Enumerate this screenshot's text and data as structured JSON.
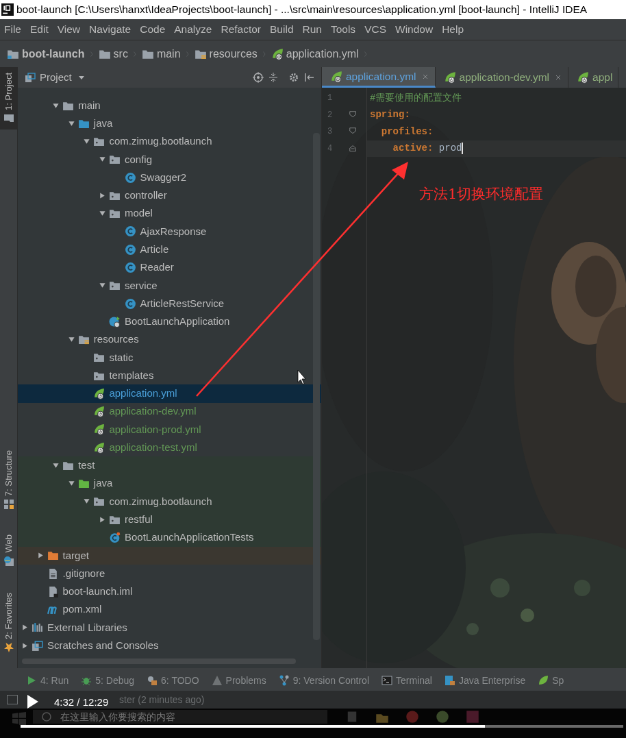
{
  "window": {
    "title": "boot-launch [C:\\Users\\hanxt\\IdeaProjects\\boot-launch] - ...\\src\\main\\resources\\application.yml [boot-launch] - IntelliJ IDEA"
  },
  "menu": [
    "File",
    "Edit",
    "View",
    "Navigate",
    "Code",
    "Analyze",
    "Refactor",
    "Build",
    "Run",
    "Tools",
    "VCS",
    "Window",
    "Help"
  ],
  "breadcrumb": [
    {
      "label": "boot-launch",
      "kind": "module"
    },
    {
      "label": "src",
      "kind": "folder"
    },
    {
      "label": "main",
      "kind": "folder"
    },
    {
      "label": "resources",
      "kind": "resources"
    },
    {
      "label": "application.yml",
      "kind": "spring-yml"
    }
  ],
  "left_tool_strip": [
    {
      "label": "1: Project",
      "kind": "project",
      "selected": true
    },
    {
      "label": "7: Structure",
      "kind": "structure",
      "selected": false
    },
    {
      "label": "Web",
      "kind": "web",
      "selected": false
    },
    {
      "label": "2: Favorites",
      "kind": "star",
      "selected": false
    }
  ],
  "project_panel": {
    "title": "Project",
    "src_children": [
      {
        "label": "main",
        "kind": "folder",
        "expanded": true,
        "selected": false,
        "added": false,
        "children": [
          {
            "label": "java",
            "kind": "source",
            "expanded": true,
            "selected": false,
            "added": false,
            "children": [
              {
                "label": "com.zimug.bootlaunch",
                "kind": "package",
                "expanded": true,
                "selected": false,
                "added": false,
                "children": [
                  {
                    "label": "config",
                    "kind": "package",
                    "expanded": true,
                    "selected": false,
                    "added": false,
                    "children": [
                      {
                        "label": "Swagger2",
                        "kind": "class",
                        "selected": false,
                        "added": false
                      }
                    ]
                  },
                  {
                    "label": "controller",
                    "kind": "package",
                    "expanded": false,
                    "selected": false,
                    "added": false
                  },
                  {
                    "label": "model",
                    "kind": "package",
                    "expanded": true,
                    "selected": false,
                    "added": false,
                    "children": [
                      {
                        "label": "AjaxResponse",
                        "kind": "class",
                        "selected": false,
                        "added": false
                      },
                      {
                        "label": "Article",
                        "kind": "class",
                        "selected": false,
                        "added": false
                      },
                      {
                        "label": "Reader",
                        "kind": "class",
                        "selected": false,
                        "added": false
                      }
                    ]
                  },
                  {
                    "label": "service",
                    "kind": "package",
                    "expanded": true,
                    "selected": false,
                    "added": false,
                    "children": [
                      {
                        "label": "ArticleRestService",
                        "kind": "class",
                        "selected": false,
                        "added": false
                      }
                    ]
                  },
                  {
                    "label": "BootLaunchApplication",
                    "kind": "spring-class",
                    "selected": false,
                    "added": false
                  }
                ]
              }
            ]
          },
          {
            "label": "resources",
            "kind": "resources",
            "expanded": true,
            "selected": false,
            "added": false,
            "children": [
              {
                "label": "static",
                "kind": "package",
                "selected": false,
                "added": false
              },
              {
                "label": "templates",
                "kind": "package",
                "selected": false,
                "added": false
              },
              {
                "label": "application.yml",
                "kind": "spring-yml",
                "selected": true,
                "added": true
              },
              {
                "label": "application-dev.yml",
                "kind": "spring-yml",
                "selected": false,
                "added": true
              },
              {
                "label": "application-prod.yml",
                "kind": "spring-yml",
                "selected": false,
                "added": true
              },
              {
                "label": "application-test.yml",
                "kind": "spring-yml",
                "selected": false,
                "added": true
              }
            ]
          }
        ]
      },
      {
        "label": "test",
        "kind": "test-folder",
        "expanded": true,
        "selected": false,
        "added": false,
        "children": [
          {
            "label": "java",
            "kind": "test-source",
            "expanded": true,
            "selected": false,
            "added": false,
            "children": [
              {
                "label": "com.zimug.bootlaunch",
                "kind": "test-package",
                "expanded": true,
                "selected": false,
                "added": false,
                "children": [
                  {
                    "label": "restful",
                    "kind": "test-package",
                    "expanded": false,
                    "selected": false,
                    "added": false
                  },
                  {
                    "label": "BootLaunchApplicationTests",
                    "kind": "test-class",
                    "selected": false,
                    "added": false
                  }
                ]
              }
            ]
          }
        ]
      }
    ],
    "module_children": [
      {
        "label": "target",
        "kind": "excluded",
        "expanded": false,
        "selected": false,
        "added": false
      },
      {
        "label": ".gitignore",
        "kind": "file",
        "selected": false,
        "added": false
      },
      {
        "label": "boot-launch.iml",
        "kind": "iml",
        "selected": false,
        "added": false
      },
      {
        "label": "pom.xml",
        "kind": "maven",
        "selected": false,
        "added": false
      }
    ],
    "root_items": [
      {
        "label": "External Libraries",
        "kind": "libraries",
        "expanded": false,
        "selected": false,
        "added": false
      },
      {
        "label": "Scratches and Consoles",
        "kind": "scratches",
        "expanded": false,
        "selected": false,
        "added": false
      }
    ]
  },
  "editor": {
    "tabs": [
      {
        "label": "application.yml",
        "selected": true,
        "closable": true
      },
      {
        "label": "application-dev.yml",
        "selected": false,
        "closable": true
      },
      {
        "label": "appl",
        "selected": false,
        "closable": false
      }
    ],
    "lines": [
      {
        "number": "1",
        "tokens": [
          {
            "text": "#需要使用的配置文件",
            "kind": "comment"
          }
        ],
        "kind": "plain",
        "caret": false
      },
      {
        "number": "2",
        "tokens": [
          {
            "text": "spring:",
            "kind": "key"
          }
        ],
        "kind": "fold-start",
        "caret": false
      },
      {
        "number": "3",
        "tokens": [
          {
            "text": "  profiles:",
            "kind": "key"
          }
        ],
        "kind": "fold-start",
        "caret": false
      },
      {
        "number": "4",
        "tokens": [
          {
            "text": "    active:",
            "kind": "key"
          },
          {
            "text": " prod",
            "kind": "value"
          }
        ],
        "kind": "fold-end",
        "caret": true
      }
    ],
    "annotation": "方法1切换环境配置"
  },
  "tool_windows": [
    {
      "label": "4: Run",
      "kind": "run"
    },
    {
      "label": "5: Debug",
      "kind": "debug"
    },
    {
      "label": "6: TODO",
      "kind": "todo"
    },
    {
      "label": "Problems",
      "kind": "problems"
    },
    {
      "label": "9: Version Control",
      "kind": "vcs"
    },
    {
      "label": "Terminal",
      "kind": "terminal"
    },
    {
      "label": "Java Enterprise",
      "kind": "enterprise"
    },
    {
      "label": "Sp",
      "kind": "spring"
    }
  ],
  "status_bar": {
    "message": "ster (2 minutes ago)"
  },
  "taskbar": {
    "search_placeholder": "在这里输入你要搜索的内容"
  },
  "video_player": {
    "time": "4:32 / 12:29",
    "level": 0.77
  }
}
